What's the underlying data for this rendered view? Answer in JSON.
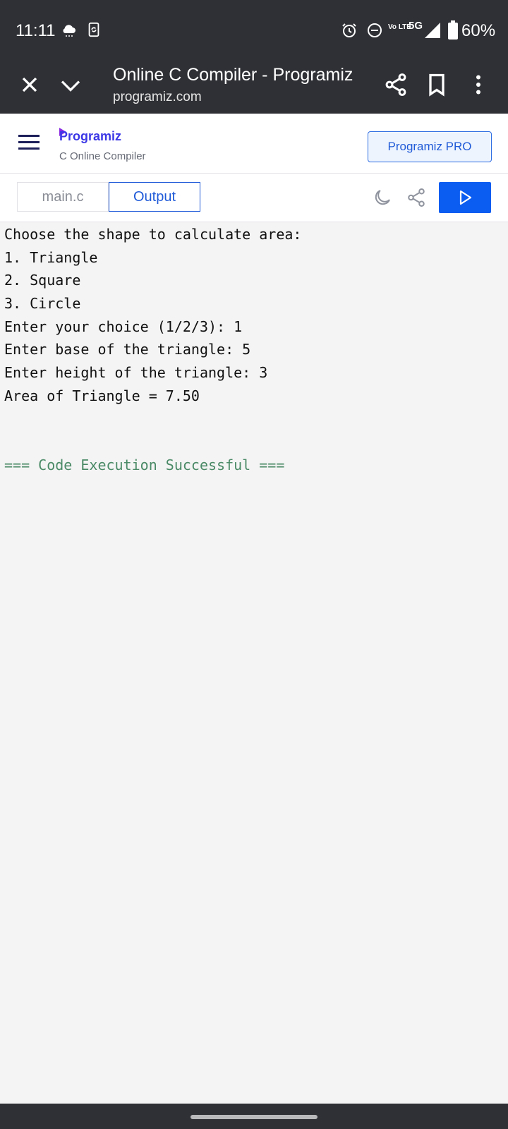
{
  "status_bar": {
    "time": "11:11",
    "network": "5G",
    "volte": "Vo LTE",
    "battery": "60%"
  },
  "browser": {
    "page_title": "Online C Compiler - Programiz",
    "url": "programiz.com"
  },
  "site_header": {
    "brand": "Programiz",
    "subtitle": "C Online Compiler",
    "pro_button": "Programiz PRO"
  },
  "toolbar": {
    "tabs": [
      {
        "label": "main.c"
      },
      {
        "label": "Output"
      }
    ]
  },
  "output": {
    "lines": [
      "Choose the shape to calculate area:",
      "1. Triangle",
      "2. Square",
      "3. Circle",
      "Enter your choice (1/2/3): 1",
      "Enter base of the triangle: 5",
      "Enter height of the triangle: 3",
      "Area of Triangle = 7.50"
    ],
    "success_message": "=== Code Execution Successful ==="
  },
  "colors": {
    "accent": "#0b5cf0",
    "bar_dark": "#2f3035",
    "success": "#4b8a66"
  }
}
